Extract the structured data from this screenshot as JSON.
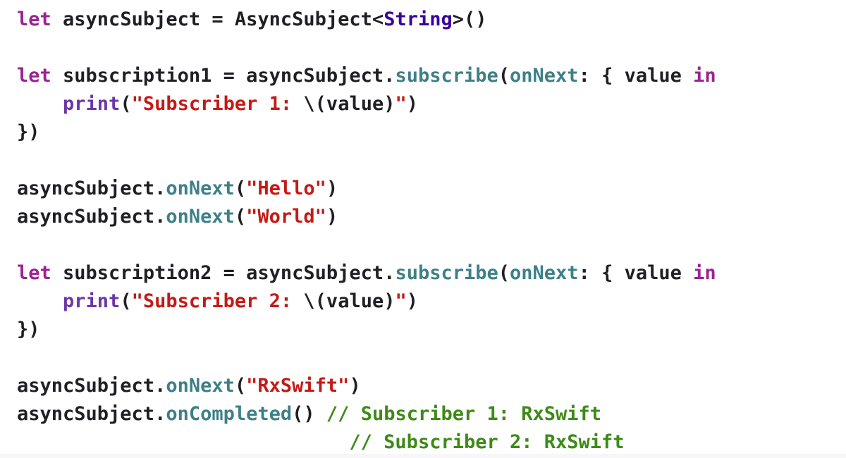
{
  "code": {
    "lines": [
      [
        {
          "t": "let",
          "c": "kw"
        },
        {
          "t": " asyncSubject = AsyncSubject<",
          "c": "plain"
        },
        {
          "t": "String",
          "c": "type"
        },
        {
          "t": ">()",
          "c": "plain"
        }
      ],
      [],
      [
        {
          "t": "let",
          "c": "kw"
        },
        {
          "t": " subscription1 = asyncSubject.",
          "c": "plain"
        },
        {
          "t": "subscribe",
          "c": "method"
        },
        {
          "t": "(",
          "c": "plain"
        },
        {
          "t": "onNext",
          "c": "method"
        },
        {
          "t": ": { value ",
          "c": "plain"
        },
        {
          "t": "in",
          "c": "kw"
        }
      ],
      [
        {
          "t": "    ",
          "c": "plain"
        },
        {
          "t": "print",
          "c": "func"
        },
        {
          "t": "(",
          "c": "plain"
        },
        {
          "t": "\"Subscriber 1: ",
          "c": "str"
        },
        {
          "t": "\\(value)",
          "c": "plain"
        },
        {
          "t": "\"",
          "c": "str"
        },
        {
          "t": ")",
          "c": "plain"
        }
      ],
      [
        {
          "t": "})",
          "c": "plain"
        }
      ],
      [],
      [
        {
          "t": "asyncSubject.",
          "c": "plain"
        },
        {
          "t": "onNext",
          "c": "method"
        },
        {
          "t": "(",
          "c": "plain"
        },
        {
          "t": "\"Hello\"",
          "c": "str"
        },
        {
          "t": ")",
          "c": "plain"
        }
      ],
      [
        {
          "t": "asyncSubject.",
          "c": "plain"
        },
        {
          "t": "onNext",
          "c": "method"
        },
        {
          "t": "(",
          "c": "plain"
        },
        {
          "t": "\"World\"",
          "c": "str"
        },
        {
          "t": ")",
          "c": "plain"
        }
      ],
      [],
      [
        {
          "t": "let",
          "c": "kw"
        },
        {
          "t": " subscription2 = asyncSubject.",
          "c": "plain"
        },
        {
          "t": "subscribe",
          "c": "method"
        },
        {
          "t": "(",
          "c": "plain"
        },
        {
          "t": "onNext",
          "c": "method"
        },
        {
          "t": ": { value ",
          "c": "plain"
        },
        {
          "t": "in",
          "c": "kw"
        }
      ],
      [
        {
          "t": "    ",
          "c": "plain"
        },
        {
          "t": "print",
          "c": "func"
        },
        {
          "t": "(",
          "c": "plain"
        },
        {
          "t": "\"Subscriber 2: ",
          "c": "str"
        },
        {
          "t": "\\(value)",
          "c": "plain"
        },
        {
          "t": "\"",
          "c": "str"
        },
        {
          "t": ")",
          "c": "plain"
        }
      ],
      [
        {
          "t": "})",
          "c": "plain"
        }
      ],
      [],
      [
        {
          "t": "asyncSubject.",
          "c": "plain"
        },
        {
          "t": "onNext",
          "c": "method"
        },
        {
          "t": "(",
          "c": "plain"
        },
        {
          "t": "\"RxSwift\"",
          "c": "str"
        },
        {
          "t": ")",
          "c": "plain"
        }
      ],
      [
        {
          "t": "asyncSubject.",
          "c": "plain"
        },
        {
          "t": "onCompleted",
          "c": "method"
        },
        {
          "t": "() ",
          "c": "plain"
        },
        {
          "t": "// Subscriber 1: RxSwift",
          "c": "comment"
        }
      ],
      [
        {
          "t": "                             ",
          "c": "plain"
        },
        {
          "t": "// Subscriber 2: RxSwift",
          "c": "comment"
        }
      ]
    ]
  },
  "colors": {
    "background": "#ffffff",
    "plain": "#1f1f24",
    "keyword": "#9b2393",
    "type": "#3900a0",
    "method": "#3e8087",
    "function": "#6c36a9",
    "string": "#c41a16",
    "comment": "#3e8a17"
  }
}
